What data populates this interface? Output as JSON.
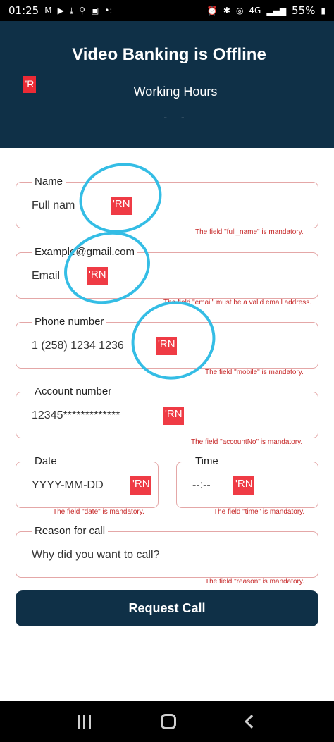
{
  "status_bar": {
    "time": "01:25",
    "battery": "55%",
    "network": "4G"
  },
  "header": {
    "title": "Video Banking is Offline",
    "subtitle": "Working Hours",
    "hours": "- -",
    "logo_text": "'R"
  },
  "badge_text": "'RN",
  "fields": {
    "name": {
      "label": "Name",
      "value": "Full nam",
      "error": "The field \"full_name\" is mandatory."
    },
    "email": {
      "label": "Example@gmail.com",
      "value": "Email",
      "error": "The field \"email\" must be a valid email address."
    },
    "phone": {
      "label": "Phone number",
      "value": "1 (258) 1234 1236",
      "error": "The field \"mobile\" is mandatory."
    },
    "account": {
      "label": "Account number",
      "value": "12345*************",
      "error": "The field \"accountNo\" is mandatory."
    },
    "date": {
      "label": "Date",
      "value": "YYYY-MM-DD",
      "error": "The field \"date\" is mandatory."
    },
    "time": {
      "label": "Time",
      "value": "--:--",
      "error": "The field \"time\" is mandatory."
    },
    "reason": {
      "label": "Reason for call",
      "value": "Why did you want to call?",
      "error": "The field \"reason\" is mandatory."
    }
  },
  "request_button": "Request Call",
  "colors": {
    "header_bg": "#0f3047",
    "badge": "#ef3b45",
    "error": "#c62828",
    "field_border": "#e4a7a7",
    "annotation": "#34bde5"
  }
}
